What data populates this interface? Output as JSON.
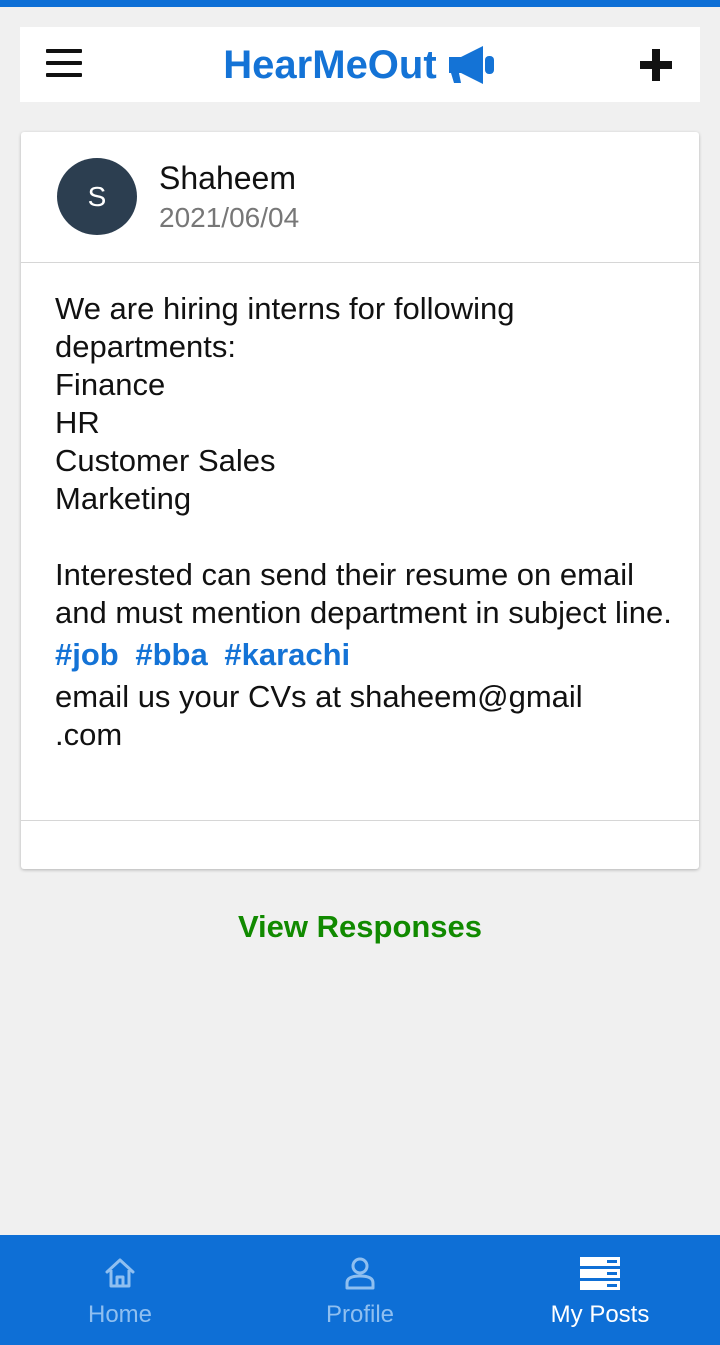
{
  "header": {
    "app_title": "HearMeOut",
    "title_icon": "megaphone-icon",
    "menu_icon": "hamburger-menu-icon",
    "add_icon": "plus-icon"
  },
  "post": {
    "avatar_initial": "S",
    "author": "Shaheem",
    "date": "2021/06/04",
    "text": "We are hiring interns for following departments:\nFinance\nHR\nCustomer Sales\nMarketing\n\nInterested can send their resume on email and must mention department in subject line.",
    "tags": [
      "#job",
      "#bba",
      "#karachi"
    ],
    "footer_text": "email us your CVs at shaheem@gmail\n.com"
  },
  "actions": {
    "view_responses": "View Responses"
  },
  "bottom_nav": {
    "items": [
      {
        "label": "Home",
        "icon": "home-icon",
        "active": false
      },
      {
        "label": "Profile",
        "icon": "profile-icon",
        "active": false
      },
      {
        "label": "My Posts",
        "icon": "posts-list-icon",
        "active": true
      }
    ]
  },
  "colors": {
    "primary": "#0e6fd6",
    "brand_text": "#1473d6",
    "action_green": "#118a00",
    "avatar_bg": "#2c3e50",
    "background": "#f0f0f0"
  }
}
